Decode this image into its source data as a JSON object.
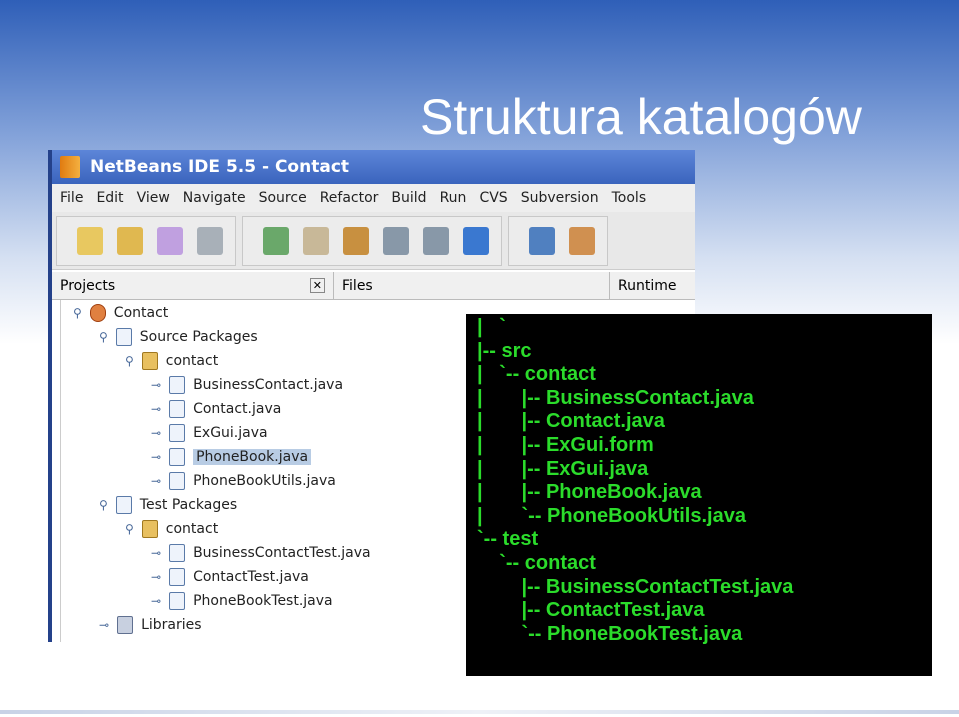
{
  "slide_title": "Struktura katalogów",
  "ide": {
    "window_title": "NetBeans IDE 5.5 - Contact",
    "menu": [
      "File",
      "Edit",
      "View",
      "Navigate",
      "Source",
      "Refactor",
      "Build",
      "Run",
      "CVS",
      "Subversion",
      "Tools"
    ],
    "toolbar_icons": [
      "new-file-icon",
      "new-project-icon",
      "open-project-icon",
      "save-all-icon",
      "cut-icon",
      "copy-icon",
      "paste-icon",
      "undo-icon",
      "redo-icon",
      "find-icon",
      "build-icon",
      "clean-build-icon"
    ],
    "tabs": [
      "Projects",
      "Files",
      "Runtime"
    ],
    "tree": [
      {
        "label": "Contact",
        "level": 0,
        "icon": "project-icon"
      },
      {
        "label": "Source Packages",
        "level": 1,
        "icon": "source-packages-icon"
      },
      {
        "label": "contact",
        "level": 2,
        "icon": "package-icon"
      },
      {
        "label": "BusinessContact.java",
        "level": 3,
        "icon": "java-file-icon"
      },
      {
        "label": "Contact.java",
        "level": 3,
        "icon": "java-file-icon"
      },
      {
        "label": "ExGui.java",
        "level": 3,
        "icon": "form-file-icon"
      },
      {
        "label": "PhoneBook.java",
        "level": 3,
        "icon": "java-file-icon",
        "selected": true
      },
      {
        "label": "PhoneBookUtils.java",
        "level": 3,
        "icon": "java-file-icon"
      },
      {
        "label": "Test Packages",
        "level": 1,
        "icon": "test-packages-icon"
      },
      {
        "label": "contact",
        "level": 2,
        "icon": "package-icon"
      },
      {
        "label": "BusinessContactTest.java",
        "level": 3,
        "icon": "test-file-icon"
      },
      {
        "label": "ContactTest.java",
        "level": 3,
        "icon": "test-file-icon"
      },
      {
        "label": "PhoneBookTest.java",
        "level": 3,
        "icon": "test-file-icon"
      },
      {
        "label": "Libraries",
        "level": 1,
        "icon": "libraries-icon"
      }
    ]
  },
  "terminal": [
    "|   `",
    "|-- src",
    "|   `-- contact",
    "|       |-- BusinessContact.java",
    "|       |-- Contact.java",
    "|       |-- ExGui.form",
    "|       |-- ExGui.java",
    "|       |-- PhoneBook.java",
    "|       `-- PhoneBookUtils.java",
    "`-- test",
    "    `-- contact",
    "        |-- BusinessContactTest.java",
    "        |-- ContactTest.java",
    "        `-- PhoneBookTest.java"
  ],
  "colors": {
    "terminal_text": "#2bdc2b",
    "terminal_bg": "#000000",
    "selection": "#b8cce4"
  }
}
